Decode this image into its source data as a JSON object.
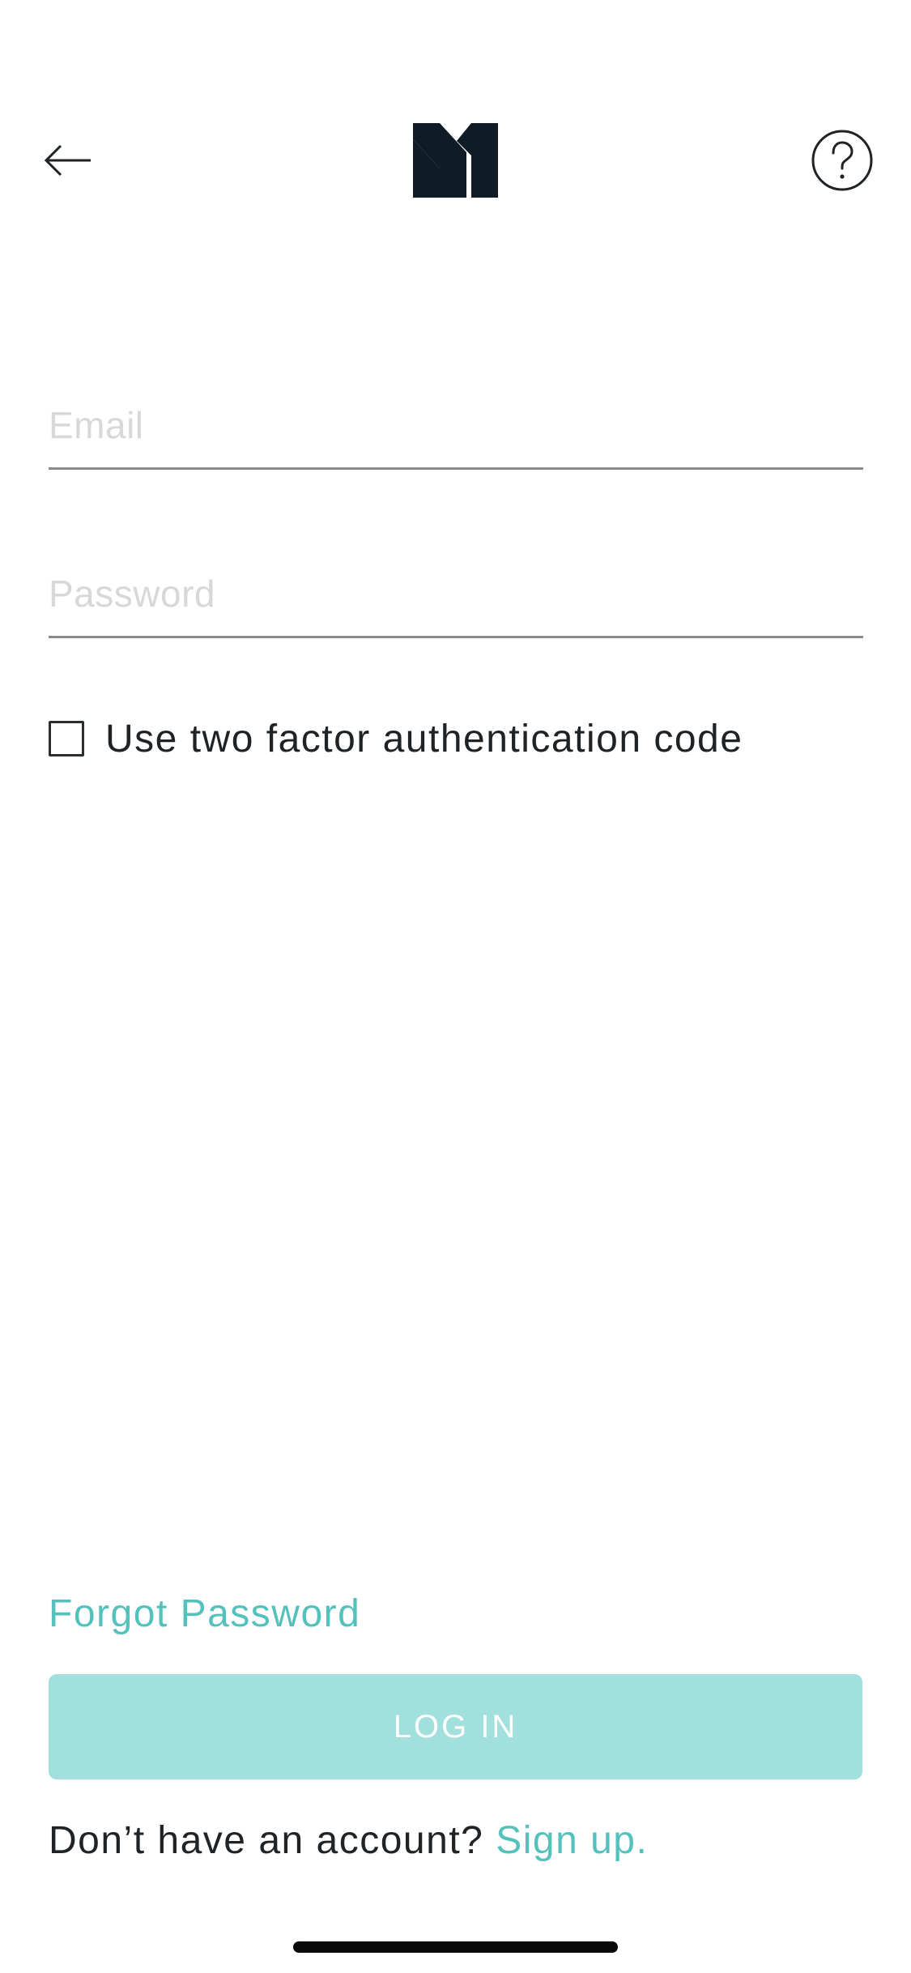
{
  "header": {
    "back_icon": "arrow-left-icon",
    "logo_icon": "m1-logo",
    "help_icon": "question-circle-icon",
    "logo_color": "#0f1c26"
  },
  "form": {
    "email_placeholder": "Email",
    "email_value": "",
    "password_placeholder": "Password",
    "password_value": "",
    "twofa_label": "Use two factor authentication code",
    "twofa_checked": false
  },
  "footer": {
    "forgot_label": "Forgot Password",
    "login_label": "LOG IN",
    "signup_prompt": "Don’t have an account?",
    "signup_link": "Sign up."
  },
  "colors": {
    "accent": "#55c1bd",
    "button_disabled": "#a2e0de",
    "text": "#1f2326",
    "underline": "#8a8a8a",
    "placeholder": "#d6d8da"
  }
}
